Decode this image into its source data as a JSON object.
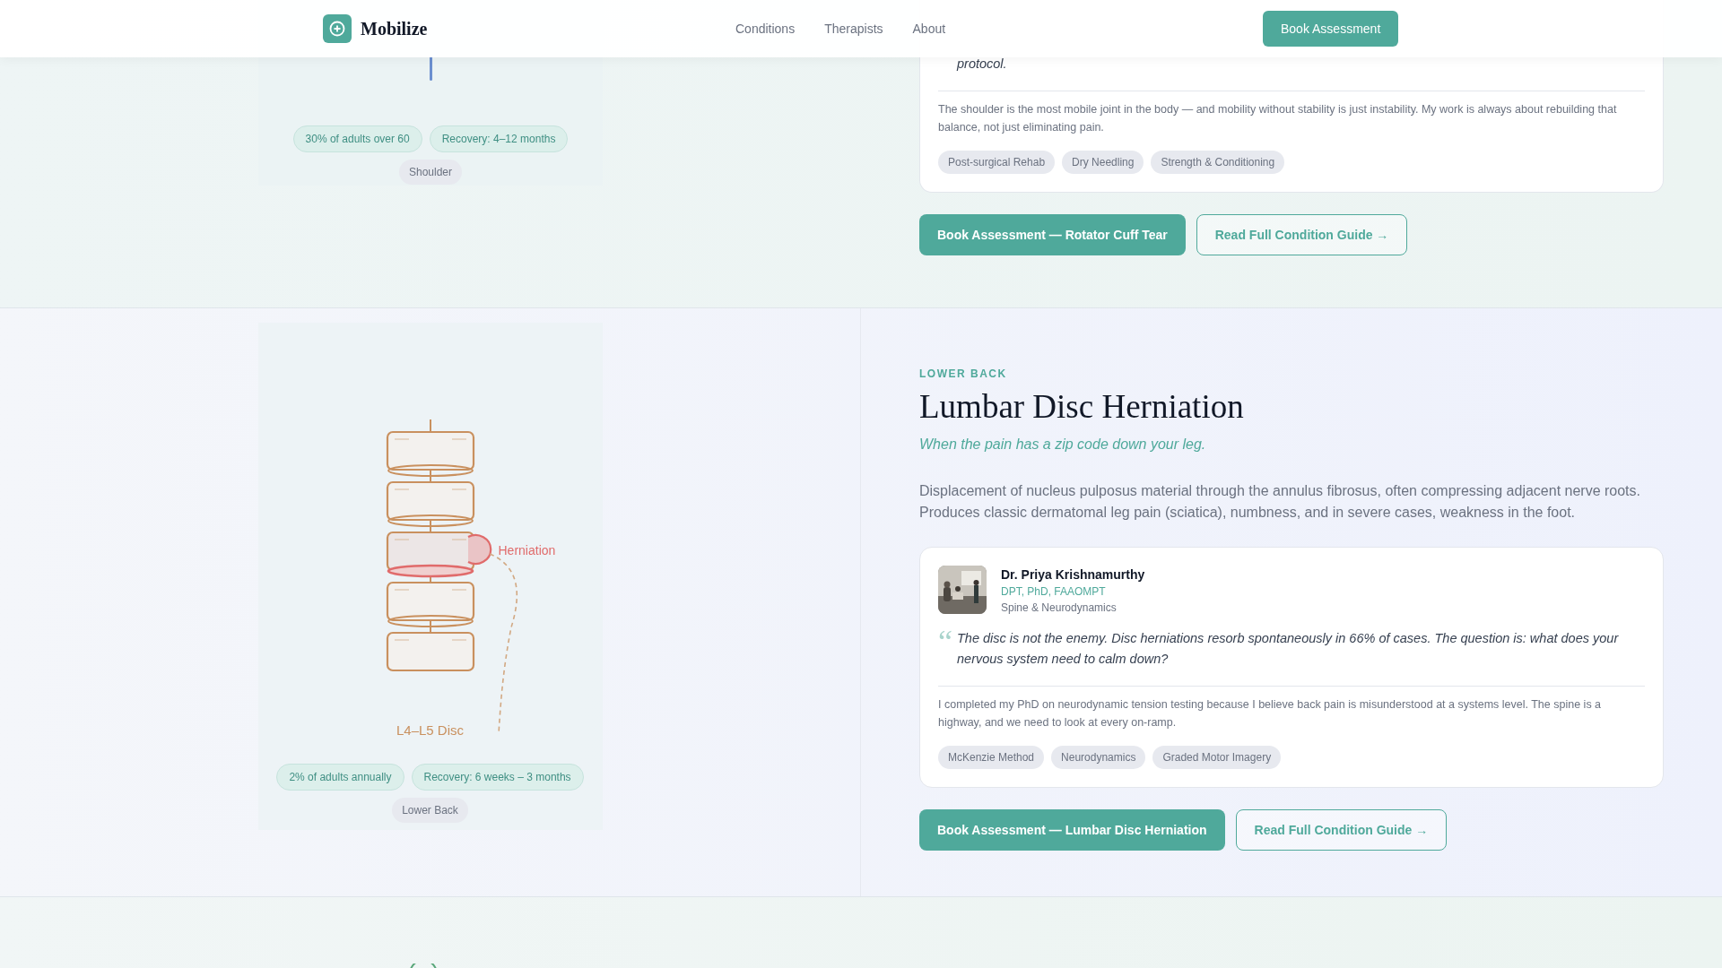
{
  "header": {
    "brand": "Mobilize",
    "nav": [
      "Conditions",
      "Therapists",
      "About"
    ],
    "cta": "Book Assessment"
  },
  "sections": [
    {
      "illustration": {
        "kind": "line",
        "stats": [
          "30% of adults over 60",
          "Recovery: 4–12 months"
        ],
        "region": "Shoulder"
      },
      "therapist": {
        "quote": "protocol.",
        "bio": "The shoulder is the most mobile joint in the body — and mobility without stability is just instability. My work is always about rebuilding that balance, not just eliminating pain.",
        "specialties": [
          "Post-surgical Rehab",
          "Dry Needling",
          "Strength & Conditioning"
        ]
      },
      "buttons": {
        "primary": "Book Assessment — Rotator Cuff Tear",
        "secondary": "Read Full Condition Guide →"
      }
    },
    {
      "region_label": "LOWER BACK",
      "title": "Lumbar Disc Herniation",
      "tagline": "When the pain has a zip code down your leg.",
      "description": "Displacement of nucleus pulposus material through the annulus fibrosus, often compressing adjacent nerve roots. Produces classic dermatomal leg pain (sciatica), numbness, and in severe cases, weakness in the foot.",
      "illustration": {
        "kind": "spine",
        "marker_label": "Herniation",
        "disc_label": "L4–L5 Disc",
        "stats": [
          "2% of adults annually",
          "Recovery: 6 weeks – 3 months"
        ],
        "region": "Lower Back"
      },
      "therapist": {
        "name": "Dr. Priya Krishnamurthy",
        "credentials": "DPT, PhD, FAAOMPT",
        "specialty": "Spine & Neurodynamics",
        "quote_mark": "“",
        "quote": "The disc is not the enemy. Disc herniations resorb spontaneously in 66% of cases. The question is: what does your nervous system need to calm down?",
        "bio": "I completed my PhD on neurodynamic tension testing because I believe back pain is misunderstood at a systems level. The spine is a highway, and we need to look at every on-ramp.",
        "specialties": [
          "McKenzie Method",
          "Neurodynamics",
          "Graded Motor Imagery"
        ]
      },
      "buttons": {
        "primary": "Book Assessment — Lumbar Disc Herniation",
        "secondary": "Read Full Condition Guide →"
      }
    }
  ]
}
